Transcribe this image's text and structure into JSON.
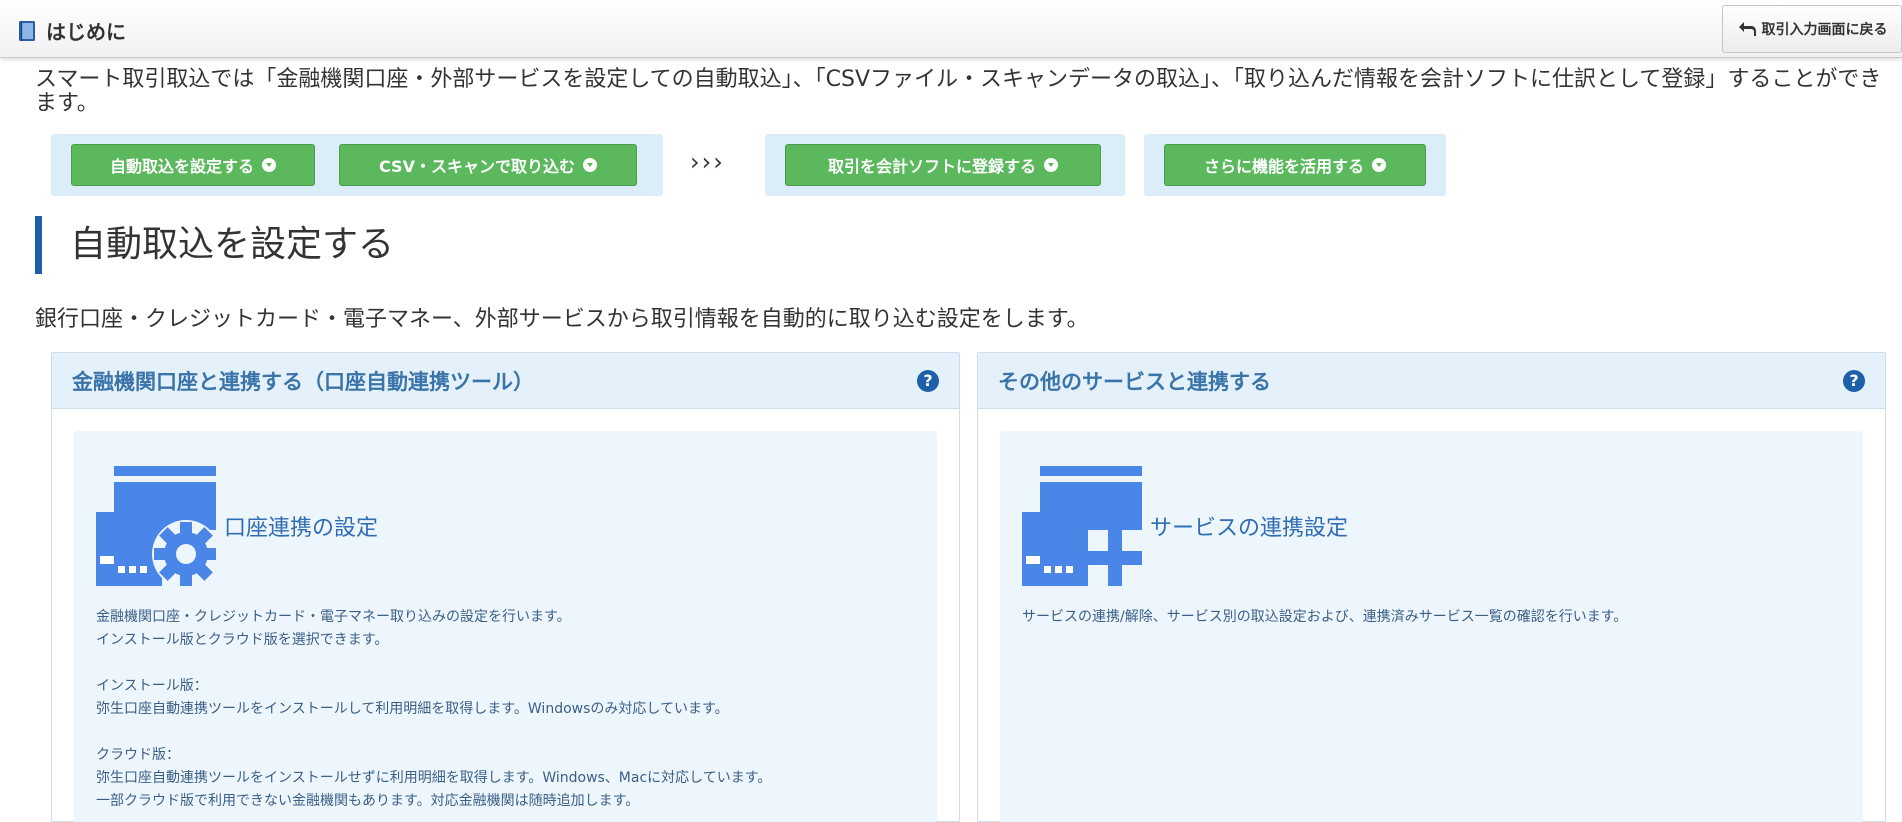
{
  "header": {
    "title": "はじめに",
    "back_button": "取引入力画面に戻る"
  },
  "intro": "スマート取引取込では「金融機関口座・外部サービスを設定しての自動取込」、「CSVファイル・スキャンデータの取込」、「取り込んだ情報を会計ソフトに仕訳として登録」することができます。",
  "nav": {
    "auto_import": "自動取込を設定する",
    "csv_scan": "CSV・スキャンで取り込む",
    "separator": "›››",
    "register": "取引を会計ソフトに登録する",
    "more": "さらに機能を活用する"
  },
  "section": {
    "title": "自動取込を設定する",
    "description": "銀行口座・クレジットカード・電子マネー、外部サービスから取引情報を自動的に取り込む設定をします。"
  },
  "panels": [
    {
      "title": "金融機関口座と連携する（口座自動連携ツール）",
      "help": "?",
      "link_label": "口座連携の設定",
      "lines": [
        "金融機関口座・クレジットカード・電子マネー取り込みの設定を行います。",
        "インストール版とクラウド版を選択できます。",
        "",
        "インストール版：",
        "弥生口座自動連携ツールをインストールして利用明細を取得します。Windowsのみ対応しています。",
        "",
        "クラウド版：",
        "弥生口座自動連携ツールをインストールせずに利用明細を取得します。Windows、Macに対応しています。",
        "一部クラウド版で利用できない金融機関もあります。対応金融機関は随時追加します。"
      ]
    },
    {
      "title": "その他のサービスと連携する",
      "help": "?",
      "link_label": "サービスの連携設定",
      "lines": [
        "サービスの連携/解除、サービス別の取込設定および、連携済みサービス一覧の確認を行います。"
      ]
    }
  ],
  "colors": {
    "accent_blue": "#1d5fa8",
    "icon_blue": "#4a86e8",
    "button_green": "#5bb85d",
    "panel_head": "#e4f1fa",
    "card_bg": "#eef6fd"
  }
}
